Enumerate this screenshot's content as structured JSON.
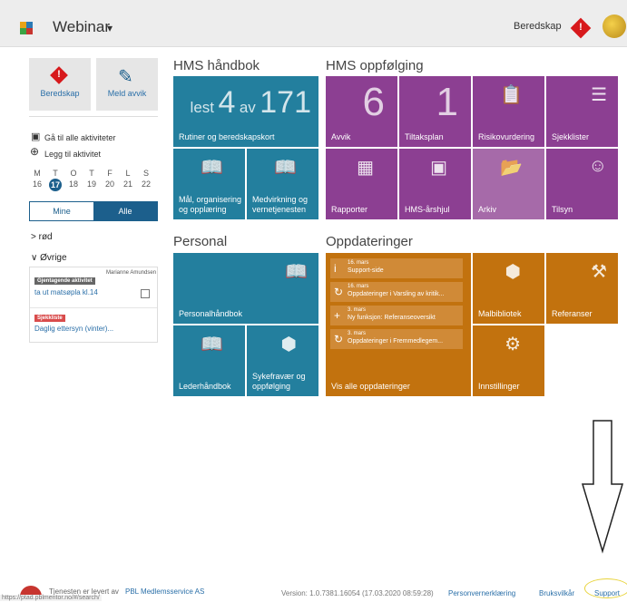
{
  "header": {
    "app_title": "Webinar",
    "caret": "▾",
    "beredskap_label": "Beredskap",
    "warning_icon": "warning-diamond-icon",
    "avatar_icon": "user-avatar-icon"
  },
  "left": {
    "beredskap_button": "Beredskap",
    "meld_avvik_button": "Meld avvik",
    "goto_all": "Gå til alle aktiviteter",
    "add_activity": "Legg til aktivitet",
    "day_names": [
      "M",
      "T",
      "O",
      "T",
      "F",
      "L",
      "S"
    ],
    "day_numbers": [
      "16",
      "17",
      "18",
      "19",
      "20",
      "21",
      "22"
    ],
    "toggle_mine": "Mine",
    "toggle_alle": "Alle",
    "group_rod": "> rød",
    "group_ovrige": "∨ Øvrige",
    "card": {
      "assignee": "Marianne Amundsen",
      "badge1": "Gjentagende aktivitet",
      "item1": "ta ut matsøpla kl.14",
      "badge2": "Sjekkliste",
      "item2": "Daglig ettersyn (vinter)..."
    }
  },
  "hms_handbok": {
    "heading": "HMS håndbok",
    "lest_label": "lest",
    "lest_count": "4",
    "av_label": "av",
    "total_count": "171",
    "rutiner": "Rutiner og beredskapskort",
    "maal": "Mål, organisering og opplæring",
    "medvirkning": "Medvirkning og vernetjenesten"
  },
  "personal": {
    "heading": "Personal",
    "personalhandbok": "Personalhåndbok",
    "lederhandbok": "Lederhåndbok",
    "sykefravaer": "Sykefravær og oppfølging"
  },
  "hms_oppfolging": {
    "heading": "HMS oppfølging",
    "avvik_count": "6",
    "avvik": "Avvik",
    "tiltaksplan_count": "1",
    "tiltaksplan": "Tiltaksplan",
    "risikovurdering": "Risikovurdering",
    "sjekklister": "Sjekklister",
    "rapporter": "Rapporter",
    "arshjul": "HMS-årshjul",
    "arkiv": "Arkiv",
    "tilsyn": "Tilsyn"
  },
  "oppdateringer": {
    "heading": "Oppdateringer",
    "items": [
      {
        "date": "16. mars",
        "text": "Support-side"
      },
      {
        "date": "16. mars",
        "text": "Oppdateringer i Varsling av kritik..."
      },
      {
        "date": "3. mars",
        "text": "Ny funksjon: Referanseoversikt"
      },
      {
        "date": "3. mars",
        "text": "Oppdateringer i Fremmedlegem..."
      }
    ],
    "vis_alle": "Vis alle oppdateringer",
    "malbibliotek": "Malbibliotek",
    "referanser": "Referanser",
    "innstillinger": "Innstillinger"
  },
  "footer": {
    "delivered_by": "Tjenesten er levert av",
    "provider": "PBL Medlemsservice AS",
    "url": "https://ptad.pblmentor.no/#/search/",
    "version": "Version: 1.0.7381.16054 (17.03.2020 08:59:28)",
    "personvern": "Personvernerklæring",
    "bruksvilkar": "Bruksvilkår",
    "support": "Support"
  },
  "colors": {
    "teal": "#237f9e",
    "purple": "#8c3f92",
    "orange": "#c2720e",
    "alert_red": "#d7191c",
    "accent_blue": "#1c5f8c"
  }
}
